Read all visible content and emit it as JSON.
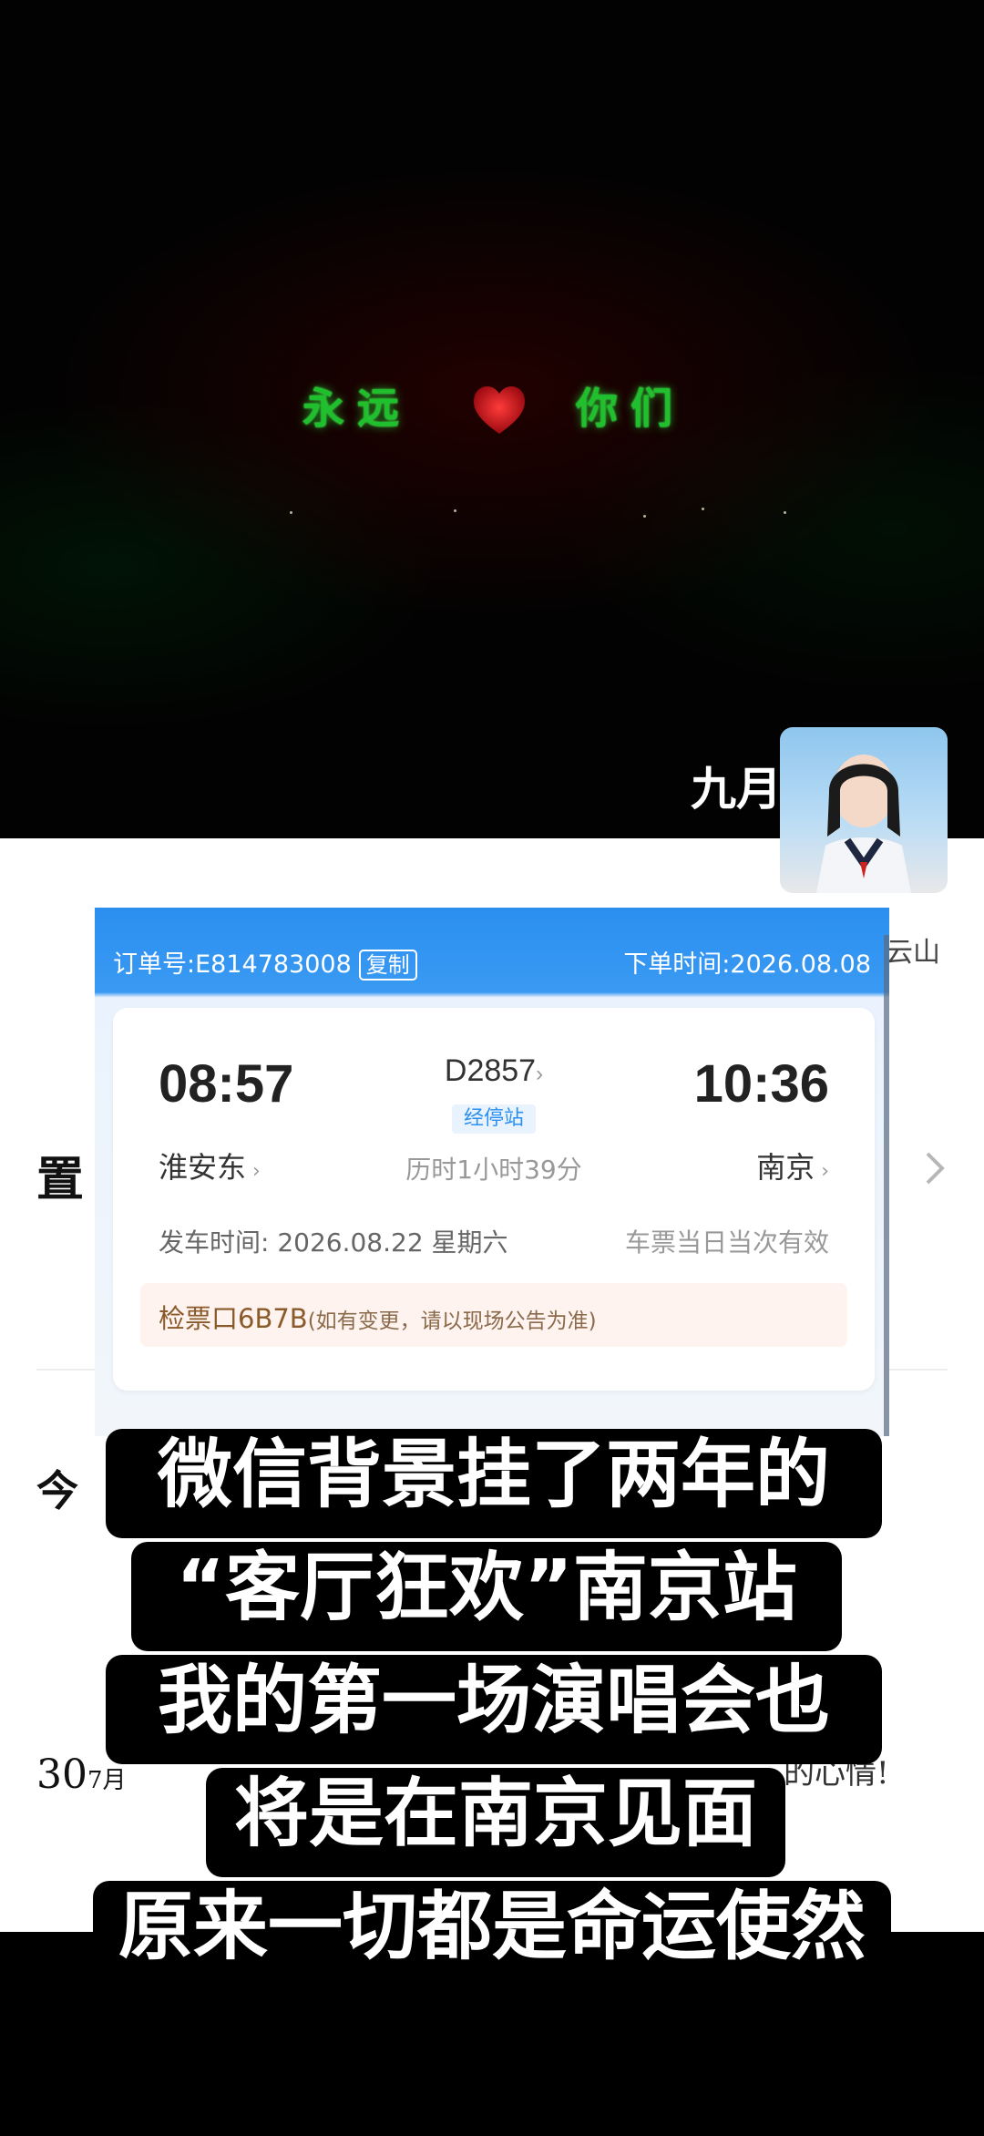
{
  "hero": {
    "led_left": "永远",
    "led_right": "你们",
    "heart_color": "#e0141e",
    "led_color": "#1fbf2e"
  },
  "profile": {
    "name": "九月"
  },
  "background_peek": {
    "right_text": "云山",
    "left_text_1": "置",
    "left_text_2": "今",
    "day": "30",
    "month": "7月",
    "right_text_2": "的心情!"
  },
  "ticket": {
    "order_label": "订单号:E814783008",
    "copy_label": "复制",
    "order_time": "下单时间:2026.08.08",
    "departure_time": "08:57",
    "arrival_time": "10:36",
    "train_number": "D2857",
    "stop_badge": "经停站",
    "departure_station": "淮安东",
    "arrival_station": "南京",
    "duration": "历时1小时39分",
    "departure_date": "发车时间: 2026.08.22 星期六",
    "validity": "车票当日当次有效",
    "gate": "检票口6B7B",
    "gate_note": "(如有变更，请以现场公告为准)",
    "brand_color": "#2b8ff0"
  },
  "captions": [
    "微信背景挂了两年的",
    "“客厅狂欢”南京站",
    "我的第一场演唱会也",
    "将是在南京见面",
    "原来一切都是命运使然"
  ]
}
